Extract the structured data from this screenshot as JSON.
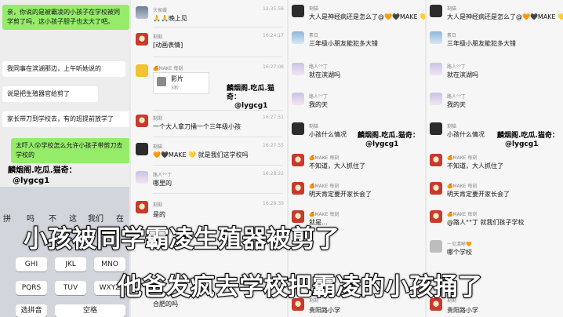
{
  "watermark": {
    "line1": "麟烟阁.吃瓜.猫奇：",
    "line2": "@lygcg1"
  },
  "panel1": {
    "bubbles": [
      "亲，你说的是被霸凌的小孩子在学校被同学剪了吗，这小孩子胆子也太大了吧。",
      "我同事在滨湖那边，上午听她说的",
      "说是把生殖器官给剪了",
      "家长带刀到学校去，有的班提前放学了",
      "太吓人😮学校怎么允许小孩子带剪刀去学校的"
    ],
    "keyboard": {
      "top_row": [
        "拼",
        "吗",
        "不",
        "这",
        "我们",
        "在"
      ],
      "keys": [
        "GHI",
        "JKL",
        "MNO",
        "PQRS",
        "TUV",
        "WXYZ",
        "选拼音",
        "空格"
      ]
    }
  },
  "panel2": {
    "messages": [
      {
        "name": "大侯缓",
        "text": "🙏🙏晚上见",
        "time": "12:35:56"
      },
      {
        "name": "剩剩",
        "text": "[动画表情]",
        "time": "16:24:17"
      },
      {
        "name": "🍊MAKE 每刻",
        "text": "影片",
        "sub": "3秒",
        "time": "16:27:08"
      },
      {
        "name": "剩剩",
        "text": "一个大人拿刀捅一个三年级小孩",
        "time": "16:27:51"
      },
      {
        "name": "剩猫",
        "text": "🧡🖤MAKE 💛 就是我们这学校吗",
        "time": "16:27:55"
      },
      {
        "name": "路人°°丁",
        "text": "哪里的",
        "time": "16:28:22"
      },
      {
        "name": "剩剩",
        "text": "是的",
        "time": "16:28:39"
      },
      {
        "name": "剩剩",
        "text": "合肥的吗",
        "time": ""
      }
    ]
  },
  "panel3": {
    "messages": [
      {
        "name": "剩猫",
        "text": "大人是神经病还是怎么了@🧡🖤MAKE 💛"
      },
      {
        "name": "素日",
        "text": "三年级小朋友能犯多大错"
      },
      {
        "name": "路人°°丁",
        "text": "就在滨湖吗"
      },
      {
        "name": "路人°°丁",
        "text": "我的天"
      },
      {
        "name": "剩猫",
        "text": "小孩什么情况"
      },
      {
        "name": "🍊MAKE 每刻",
        "text": "不知道，大人抓住了"
      },
      {
        "name": "🍊MAKE 每刻",
        "text": "明天肯定要开家长会了"
      },
      {
        "name": "🍊MAKE 每刻",
        "text": "就是..."
      },
      {
        "name": "剩剩",
        "text": "贵阳路小学"
      }
    ]
  },
  "panel4": {
    "messages": [
      {
        "name": "剩猫",
        "text": "大人是神经病还是怎么了@🧡🖤MAKE 💛"
      },
      {
        "name": "素日",
        "text": "三年级小朋友能犯多大错"
      },
      {
        "name": "路人°°丁",
        "text": "就在滨湖吗"
      },
      {
        "name": "路人°°丁",
        "text": "我的天"
      },
      {
        "name": "剩猫",
        "text": "小孩什么情况"
      },
      {
        "name": "🍊MAKE 每刻",
        "text": "不知道，大人抓住了"
      },
      {
        "name": "🍊MAKE 每刻",
        "text": "明天肯定要开家长会了"
      },
      {
        "name": "🍊MAKE 每刻",
        "text": "@路人°°丁 就我们孩子学校"
      },
      {
        "name": "一见清晰🧡",
        "text": "哪个学校"
      },
      {
        "name": "剩剩",
        "text": "贵阳路小学"
      }
    ]
  },
  "caption": {
    "line1": "小孩被同学霸凌生殖器被剪了",
    "line2": "他爸发疯去学校把霸凌的小孩捅了"
  }
}
